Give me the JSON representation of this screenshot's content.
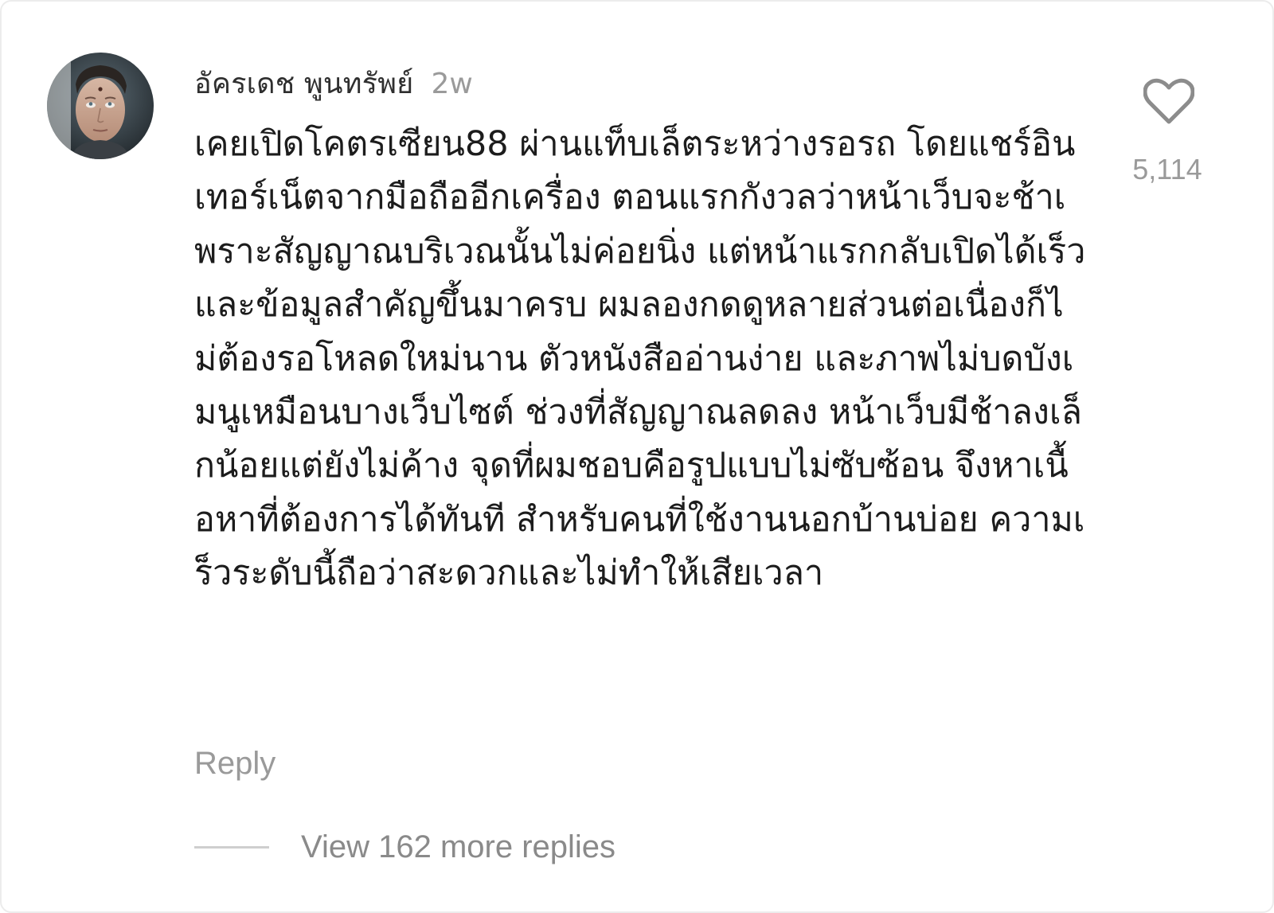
{
  "comment": {
    "username": "อัครเดช พูนทรัพย์",
    "time": "2w",
    "text": "เคยเปิดโคตรเซียน88 ผ่านแท็บเล็ตระหว่างรอรถ โดยแชร์อินเทอร์เน็ตจากมือถืออีกเครื่อง ตอนแรกกังวลว่าหน้าเว็บจะช้าเพราะสัญญาณบริเวณนั้นไม่ค่อยนิ่ง แต่หน้าแรกกลับเปิดได้เร็วและข้อมูลสำคัญขึ้นมาครบ ผมลองกดดูหลายส่วนต่อเนื่องก็ไม่ต้องรอโหลดใหม่นาน ตัวหนังสืออ่านง่าย และภาพไม่บดบังเมนูเหมือนบางเว็บไซต์ ช่วงที่สัญญาณลดลง หน้าเว็บมีช้าลงเล็กน้อยแต่ยังไม่ค้าง จุดที่ผมชอบคือรูปแบบไม่ซับซ้อน จึงหาเนื้อหาที่ต้องการได้ทันที สำหรับคนที่ใช้งานนอกบ้านบ่อย ความเร็วระดับนี้ถือว่าสะดวกและไม่ทำให้เสียเวลา",
    "like_count": "5,114",
    "reply_label": "Reply",
    "view_more_label": "View 162 more replies"
  },
  "icons": {
    "like": "heart-outline-icon",
    "avatar": "user-avatar-photo"
  },
  "colors": {
    "primary_text": "#1c1c1c",
    "secondary_text": "#9a9a9a",
    "divider": "#cfcfcf"
  }
}
